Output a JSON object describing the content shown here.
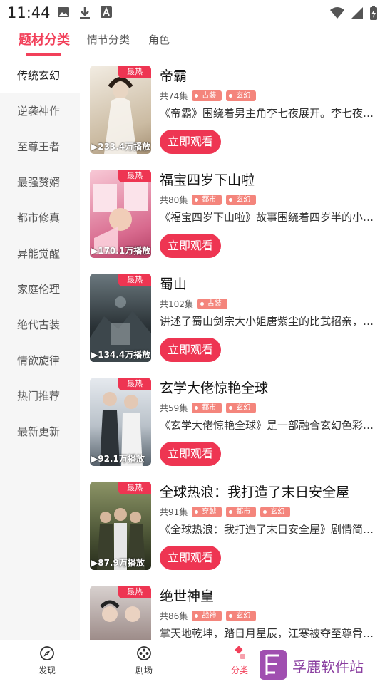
{
  "status_bar": {
    "time": "11:44",
    "icons_left": [
      "image-icon",
      "download-icon",
      "font-a-icon"
    ],
    "icons_right": [
      "wifi-icon",
      "signal-icon",
      "battery-charging-icon"
    ]
  },
  "top_tabs": [
    {
      "label": "题材分类",
      "active": true
    },
    {
      "label": "情节分类",
      "active": false
    },
    {
      "label": "角色",
      "active": false
    }
  ],
  "sidebar": {
    "items": [
      {
        "label": "传统玄幻",
        "active": true
      },
      {
        "label": "逆袭神作",
        "active": false
      },
      {
        "label": "至尊王者",
        "active": false
      },
      {
        "label": "最强赘婿",
        "active": false
      },
      {
        "label": "都市修真",
        "active": false
      },
      {
        "label": "异能觉醒",
        "active": false
      },
      {
        "label": "家庭伦理",
        "active": false
      },
      {
        "label": "绝代古装",
        "active": false
      },
      {
        "label": "情欲旋律",
        "active": false
      },
      {
        "label": "热门推荐",
        "active": false
      },
      {
        "label": "最新更新",
        "active": false
      }
    ]
  },
  "hot_badge": "最热",
  "watch_label": "立即观看",
  "dramas": [
    {
      "title": "帝霸",
      "episodes": "共74集",
      "tags": [
        "古装",
        "玄幻"
      ],
      "desc": "《帝霸》围绕着男主角李七夜展开。李七夜…",
      "plays": "233.4万播放",
      "poster_colors": [
        "#e9e2d6",
        "#c7b9a2"
      ]
    },
    {
      "title": "福宝四岁下山啦",
      "episodes": "共80集",
      "tags": [
        "都市",
        "玄幻"
      ],
      "desc": "《福宝四岁下山啦》故事围绕着四岁半的小…",
      "plays": "170.1万播放",
      "poster_colors": [
        "#f3b8c8",
        "#c9567a"
      ]
    },
    {
      "title": "蜀山",
      "episodes": "共102集",
      "tags": [
        "古装"
      ],
      "desc": "讲述了蜀山剑宗大小姐唐紫尘的比武招亲，…",
      "plays": "134.4万播放",
      "poster_colors": [
        "#5d6b72",
        "#1f262b"
      ]
    },
    {
      "title": "玄学大佬惊艳全球",
      "episodes": "共59集",
      "tags": [
        "都市",
        "玄幻"
      ],
      "desc": "《玄学大佬惊艳全球》是一部融合玄幻色彩…",
      "plays": "92.1万播放",
      "poster_colors": [
        "#d8dde4",
        "#4a5560"
      ]
    },
    {
      "title": "全球热浪：我打造了末日安全屋",
      "episodes": "共91集",
      "tags": [
        "穿越",
        "都市",
        "玄幻"
      ],
      "desc": "《全球热浪：我打造了末日安全屋》剧情简…",
      "plays": "87.9万播放",
      "poster_colors": [
        "#6f7a50",
        "#2b3222"
      ]
    },
    {
      "title": "绝世神皇",
      "episodes": "共86集",
      "tags": [
        "战神",
        "玄幻"
      ],
      "desc": "掌天地乾坤，踏日月星辰，江寒被夺至尊骨…",
      "plays": "",
      "poster_colors": [
        "#c9c2c0",
        "#5d4a48"
      ]
    }
  ],
  "bottom_nav": [
    {
      "label": "发现",
      "icon": "compass-icon"
    },
    {
      "label": "剧场",
      "icon": "film-reel-icon"
    },
    {
      "label": "分类",
      "icon": "category-icon"
    }
  ],
  "watermark": {
    "text": "孚鹿软件站"
  }
}
